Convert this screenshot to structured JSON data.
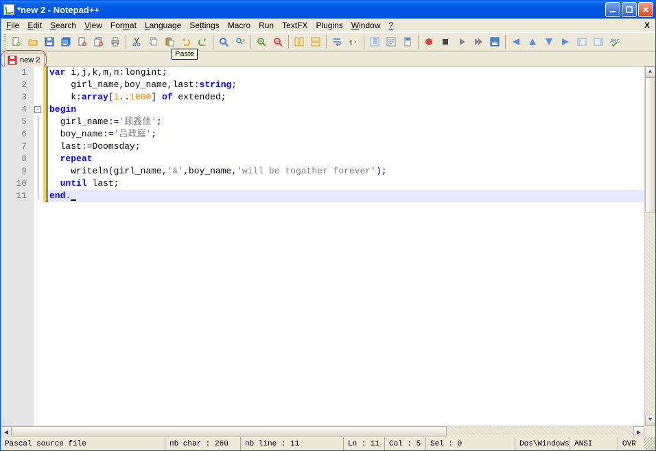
{
  "window": {
    "title": "*new 2 - Notepad++"
  },
  "menu": {
    "items": [
      "File",
      "Edit",
      "Search",
      "View",
      "Format",
      "Language",
      "Settings",
      "Macro",
      "Run",
      "TextFX",
      "Plugins",
      "Window",
      "?"
    ],
    "closeX": "X"
  },
  "toolbar": {
    "tooltip": "Paste",
    "icons": [
      "new-file-icon",
      "open-file-icon",
      "save-icon",
      "save-all-icon",
      "close-file-icon",
      "close-all-icon",
      "print-icon",
      "cut-icon",
      "copy-icon",
      "paste-icon",
      "undo-icon",
      "redo-icon",
      "find-icon",
      "replace-icon",
      "zoom-in-icon",
      "zoom-out-icon",
      "sync-v-icon",
      "sync-h-icon",
      "wrap-icon",
      "all-chars-icon",
      "indent-guide-icon",
      "record-macro-icon",
      "stop-macro-icon",
      "play-macro-icon",
      "play-multi-icon",
      "save-macro-icon",
      "tri-left-icon",
      "tri-up-icon",
      "tri-down-icon",
      "tri-right-icon",
      "panel-a-icon",
      "panel-b-icon",
      "spellcheck-icon"
    ]
  },
  "tabs": {
    "active": {
      "label": "new 2",
      "modified": true
    }
  },
  "editor": {
    "lines": [
      {
        "n": 1,
        "seg": [
          {
            "c": "kw",
            "t": "var"
          },
          {
            "c": "ident",
            "t": " i"
          },
          {
            "c": "op",
            "t": ","
          },
          {
            "c": "ident",
            "t": "j"
          },
          {
            "c": "op",
            "t": ","
          },
          {
            "c": "ident",
            "t": "k"
          },
          {
            "c": "op",
            "t": ","
          },
          {
            "c": "ident",
            "t": "m"
          },
          {
            "c": "op",
            "t": ","
          },
          {
            "c": "ident",
            "t": "n"
          },
          {
            "c": "op",
            "t": ":"
          },
          {
            "c": "type",
            "t": "longint"
          },
          {
            "c": "op",
            "t": ";"
          }
        ],
        "indent": 0
      },
      {
        "n": 2,
        "seg": [
          {
            "c": "ident",
            "t": "girl_name"
          },
          {
            "c": "op",
            "t": ","
          },
          {
            "c": "ident",
            "t": "boy_name"
          },
          {
            "c": "op",
            "t": ","
          },
          {
            "c": "ident",
            "t": "last"
          },
          {
            "c": "op",
            "t": ":"
          },
          {
            "c": "kw",
            "t": "string"
          },
          {
            "c": "op",
            "t": ";"
          }
        ],
        "indent": 2
      },
      {
        "n": 3,
        "seg": [
          {
            "c": "ident",
            "t": "k"
          },
          {
            "c": "op",
            "t": ":"
          },
          {
            "c": "kw",
            "t": "array"
          },
          {
            "c": "op",
            "t": "["
          },
          {
            "c": "num",
            "t": "1"
          },
          {
            "c": "op",
            "t": ".."
          },
          {
            "c": "num",
            "t": "1000"
          },
          {
            "c": "op",
            "t": "]"
          },
          {
            "c": "ident",
            "t": " "
          },
          {
            "c": "kw",
            "t": "of"
          },
          {
            "c": "ident",
            "t": " extended"
          },
          {
            "c": "op",
            "t": ";"
          }
        ],
        "indent": 2
      },
      {
        "n": 4,
        "seg": [
          {
            "c": "kw",
            "t": "begin"
          }
        ],
        "indent": 0,
        "fold": true
      },
      {
        "n": 5,
        "seg": [
          {
            "c": "ident",
            "t": "girl_name"
          },
          {
            "c": "op",
            "t": ":="
          },
          {
            "c": "str",
            "t": "'顾鑫佳'"
          },
          {
            "c": "op",
            "t": ";"
          }
        ],
        "indent": 1
      },
      {
        "n": 6,
        "seg": [
          {
            "c": "ident",
            "t": "boy_name"
          },
          {
            "c": "op",
            "t": ":="
          },
          {
            "c": "str",
            "t": "'吕政庭'"
          },
          {
            "c": "op",
            "t": ";"
          }
        ],
        "indent": 1
      },
      {
        "n": 7,
        "seg": [
          {
            "c": "ident",
            "t": "last"
          },
          {
            "c": "op",
            "t": ":="
          },
          {
            "c": "ident",
            "t": "Doomsday"
          },
          {
            "c": "op",
            "t": ";"
          }
        ],
        "indent": 1
      },
      {
        "n": 8,
        "seg": [
          {
            "c": "kw",
            "t": "repeat"
          }
        ],
        "indent": 1
      },
      {
        "n": 9,
        "seg": [
          {
            "c": "ident",
            "t": "writeln"
          },
          {
            "c": "op",
            "t": "("
          },
          {
            "c": "ident",
            "t": "girl_name"
          },
          {
            "c": "op",
            "t": ","
          },
          {
            "c": "str",
            "t": "'&'"
          },
          {
            "c": "op",
            "t": ","
          },
          {
            "c": "ident",
            "t": "boy_name"
          },
          {
            "c": "op",
            "t": ","
          },
          {
            "c": "str",
            "t": "'will be togather forever'"
          },
          {
            "c": "op",
            "t": ");"
          }
        ],
        "indent": 2
      },
      {
        "n": 10,
        "seg": [
          {
            "c": "kw",
            "t": "until"
          },
          {
            "c": "ident",
            "t": " last"
          },
          {
            "c": "op",
            "t": ";"
          }
        ],
        "indent": 1
      },
      {
        "n": 11,
        "seg": [
          {
            "c": "kw",
            "t": "end"
          },
          {
            "c": "op",
            "t": "."
          }
        ],
        "indent": 0,
        "current": true,
        "cursor": true
      }
    ]
  },
  "status": {
    "filetype": "Pascal source file",
    "nbchar": "nb char : 260",
    "nbline": "nb line : 11",
    "ln": "Ln : 11",
    "col": "Col : 5",
    "sel": "Sel : 0",
    "eol": "Dos\\Windows",
    "enc": "ANSI",
    "ovr": "OVR"
  }
}
